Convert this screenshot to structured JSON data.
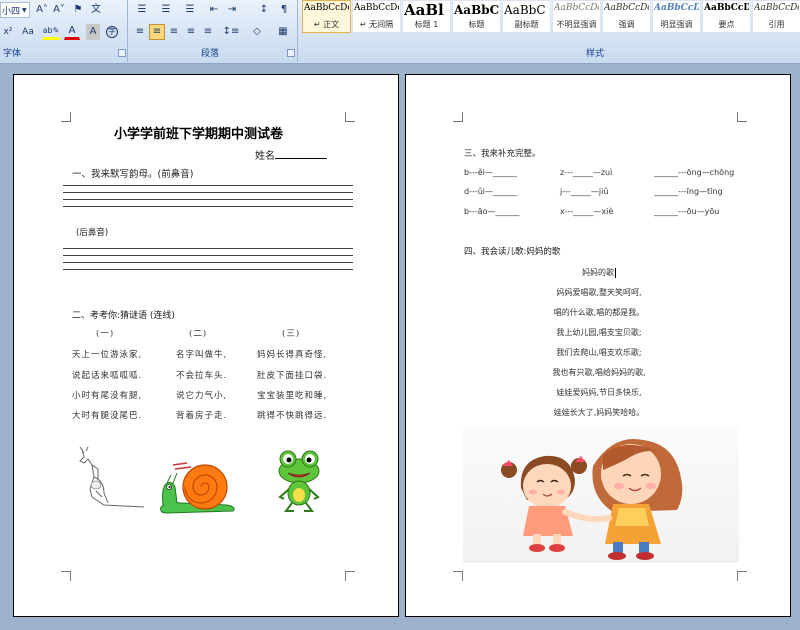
{
  "ribbon": {
    "font_size_value": "小四",
    "group_labels": {
      "font": "字体",
      "paragraph": "段落",
      "styles": "样式"
    },
    "font_buttons": {
      "grow": "A˄",
      "shrink": "A˅",
      "clear": "⚑",
      "phonetic": "文",
      "superscript": "x²",
      "change_case": "Aa",
      "highlight": "ab✎",
      "font_color": "A",
      "char_shading": "A",
      "enclose": "字"
    },
    "para_buttons": {
      "bullets": "☰",
      "numbering": "☰",
      "multilevel": "☰",
      "decrease_indent": "⇤",
      "increase_indent": "⇥",
      "sort": "↕",
      "show_marks": "¶",
      "align_left": "≡",
      "center": "≡",
      "align_right": "≡",
      "justify": "≡",
      "distribute": "≡",
      "line_spacing": "↕≡",
      "shading": "◇",
      "borders": "▦"
    },
    "styles": [
      {
        "sample": "AaBbCcDd",
        "name": "↵ 正文",
        "selected": true
      },
      {
        "sample": "AaBbCcDd",
        "name": "↵ 无间隔",
        "selected": false
      },
      {
        "sample": "AaBl",
        "name": "标题 1",
        "selected": false
      },
      {
        "sample": "AaBbC",
        "name": "标题",
        "selected": false
      },
      {
        "sample": "AaBbC",
        "name": "副标题",
        "selected": false
      },
      {
        "sample": "AaBbCcDd",
        "name": "不明显强调",
        "selected": false
      },
      {
        "sample": "AaBbCcDd",
        "name": "强调",
        "selected": false
      },
      {
        "sample": "AaBbCcDd",
        "name": "明显强调",
        "selected": false
      },
      {
        "sample": "AaBbCcD",
        "name": "要点",
        "selected": false
      },
      {
        "sample": "AaBbCcDd",
        "name": "引用",
        "selected": false
      }
    ]
  },
  "page1": {
    "title": "小学学前班下学期期中测试卷",
    "name_label": "姓名",
    "section1": "一、我来默写韵母。(前鼻音)",
    "sub_back_nasal": "(后鼻音)",
    "section2": "二、考考你:猜谜语 (连线)",
    "riddle_headers": [
      "(一)",
      "(二)",
      "(三)"
    ],
    "riddles": [
      [
        "天上一位游泳家,",
        "名字叫做牛,",
        "妈妈长得真奇怪,"
      ],
      [
        "说起话来呱呱呱.",
        "不会拉车头.",
        "肚皮下面挂口袋."
      ],
      [
        "小时有尾没有腿,",
        "说它力气小,",
        "宝宝装里吃和睡,"
      ],
      [
        "大时有腿没尾巴.",
        "背着房子走.",
        "跳得不快跳得远."
      ]
    ],
    "pictures": [
      "kangaroo",
      "snail",
      "frog"
    ]
  },
  "page2": {
    "section3": "三、我来补充完整。",
    "pinyin_rows": [
      [
        "b---ěi—______",
        "z---_____—zuì",
        "______---ōng—chōng"
      ],
      [
        "d---ǔi—______",
        "j---_____—jiǔ",
        "______---īng—tīng"
      ],
      [
        "b---āo—______",
        "x---_____—xiè",
        "______---ōu—yōu"
      ]
    ],
    "section4": "四、我会读儿歌:妈妈的歌",
    "poem_title": "妈妈的歌",
    "poem_lines": [
      "妈妈爱唱歌,整天笑呵呵,",
      "唱的什么歌,唱的都是我。",
      "我上幼儿园,唱支宝贝歌;",
      "我们去爬山,唱支欢乐歌;",
      "我也有只歌,唱给妈妈的歌,",
      "娃娃爱妈妈,节日多快乐,",
      "娃娃长大了,妈妈笑哈哈。"
    ]
  }
}
